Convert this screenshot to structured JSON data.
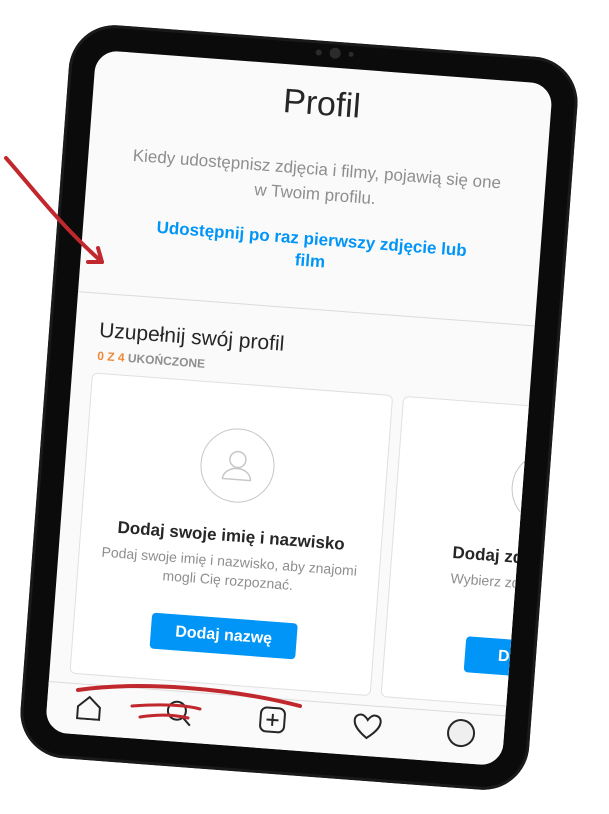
{
  "header": {
    "title": "Profil"
  },
  "empty_state": {
    "description": "Kiedy udostępnisz zdjęcia i filmy, pojawią się one w Twoim profilu.",
    "share_link": "Udostępnij po raz pierwszy zdjęcie lub film"
  },
  "complete_profile": {
    "title": "Uzupełnij swój profil",
    "progress_highlight": "0 Z 4",
    "progress_label": "UKOŃCZONE",
    "completed": 0,
    "total": 4
  },
  "cards": [
    {
      "title": "Dodaj swoje imię i nazwisko",
      "description": "Podaj swoje imię i nazwisko, aby znajomi mogli Cię rozpoznać.",
      "button": "Dodaj nazwę",
      "icon": "person-icon"
    },
    {
      "title": "Dodaj zdjęcie pr",
      "description": "Wybierz zdjęcie pr aby zaprezentowa",
      "button": "Dodaj zdję",
      "icon": "profile-photo-icon"
    }
  ],
  "bottom_nav": {
    "icons": [
      "home-icon",
      "search-icon",
      "add-post-icon",
      "activity-heart-icon",
      "profile-avatar-icon"
    ]
  },
  "colors": {
    "accent_blue": "#0095f6",
    "progress_orange": "#ed8936",
    "annotation_red": "#c0282d"
  }
}
